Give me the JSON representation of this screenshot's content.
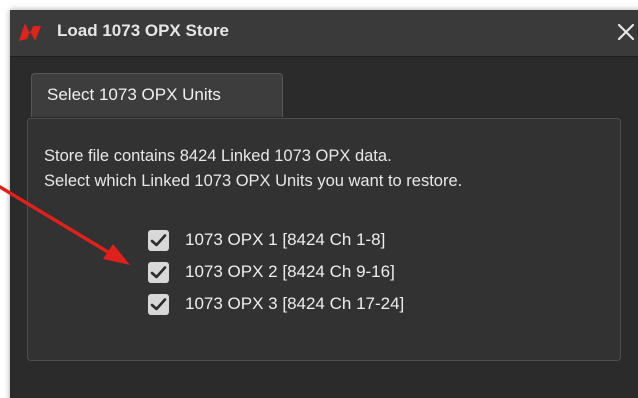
{
  "window": {
    "title": "Load 1073 OPX Store",
    "close_glyph": "✕",
    "app_icon": "red-n-logo-icon"
  },
  "tab": {
    "label": "Select 1073 OPX Units"
  },
  "panel": {
    "line1": "Store file contains 8424 Linked 1073 OPX data.",
    "line2": "Select which Linked 1073 OPX Units you want to restore."
  },
  "units": [
    {
      "label": "1073 OPX 1  [8424 Ch 1-8]",
      "checked": true
    },
    {
      "label": "1073 OPX 2  [8424 Ch 9-16]",
      "checked": true
    },
    {
      "label": "1073 OPX 3  [8424 Ch 17-24]",
      "checked": true
    }
  ],
  "colors": {
    "window_bg": "#2b2b2b",
    "titlebar_bg": "#3a3a3a",
    "panel_bg": "#323232",
    "checkbox_bg": "#d8d8d8",
    "checkmark": "#2b2b2b",
    "logo_red": "#e2231a",
    "annotation_arrow": "#e0201b"
  }
}
